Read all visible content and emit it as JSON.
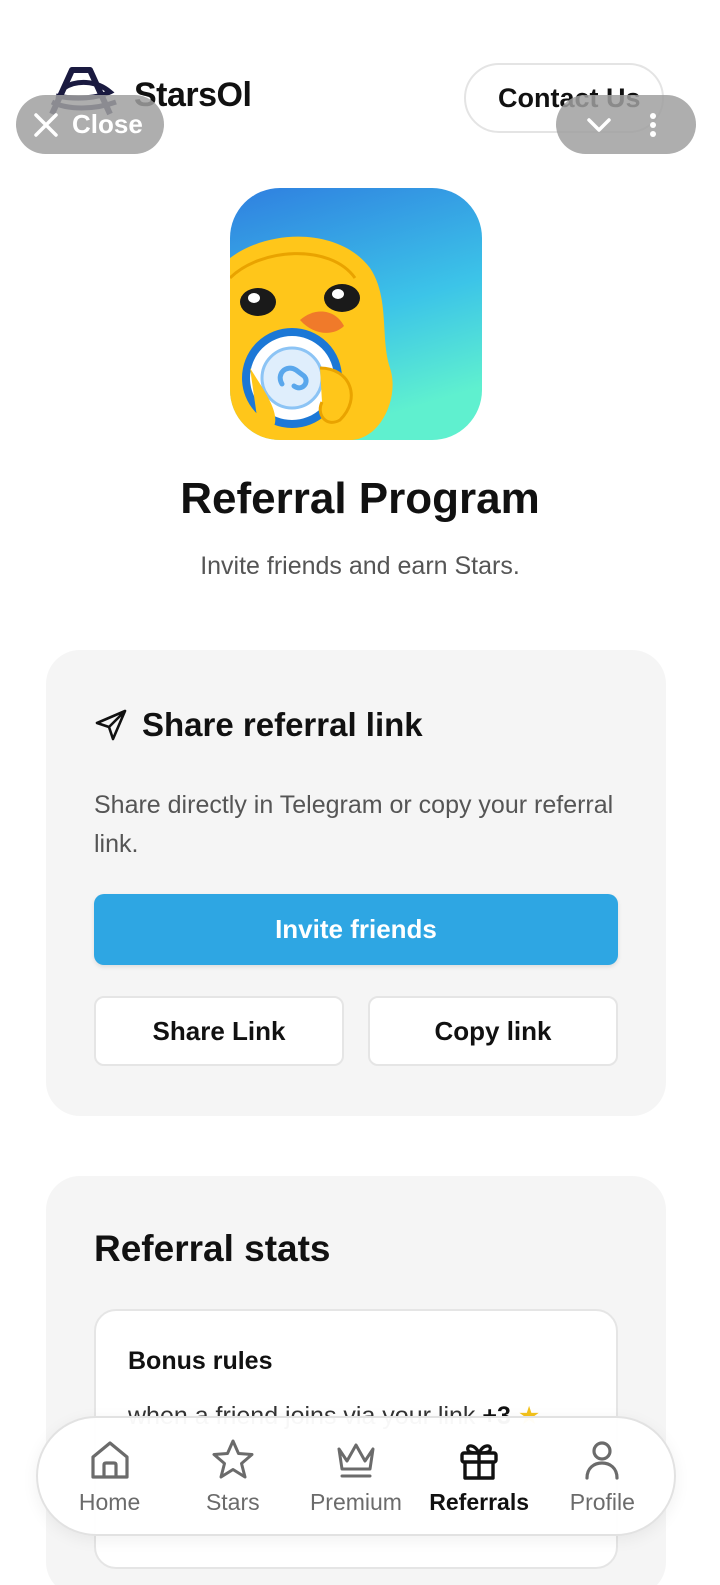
{
  "header": {
    "brand": "StarsOl",
    "contact_label": "Contact Us",
    "close_label": "Close"
  },
  "hero": {
    "title": "Referral Program",
    "subtitle": "Invite friends and earn Stars."
  },
  "share_card": {
    "title": "Share referral link",
    "description": "Share directly in Telegram or copy your referral link.",
    "invite_label": "Invite friends",
    "share_label": "Share Link",
    "copy_label": "Copy link"
  },
  "stats_card": {
    "title": "Referral stats",
    "rules_title": "Bonus rules",
    "rules_line": "when a friend joins via your link",
    "rules_bonus": "+3"
  },
  "nav": {
    "items": [
      {
        "label": "Home",
        "icon": "home-icon"
      },
      {
        "label": "Stars",
        "icon": "star-icon"
      },
      {
        "label": "Premium",
        "icon": "crown-icon"
      },
      {
        "label": "Referrals",
        "icon": "gift-icon",
        "active": true
      },
      {
        "label": "Profile",
        "icon": "user-icon"
      }
    ]
  },
  "colors": {
    "accent": "#2ea6e3",
    "card_bg": "#f5f5f5",
    "star": "#f3c21c"
  }
}
